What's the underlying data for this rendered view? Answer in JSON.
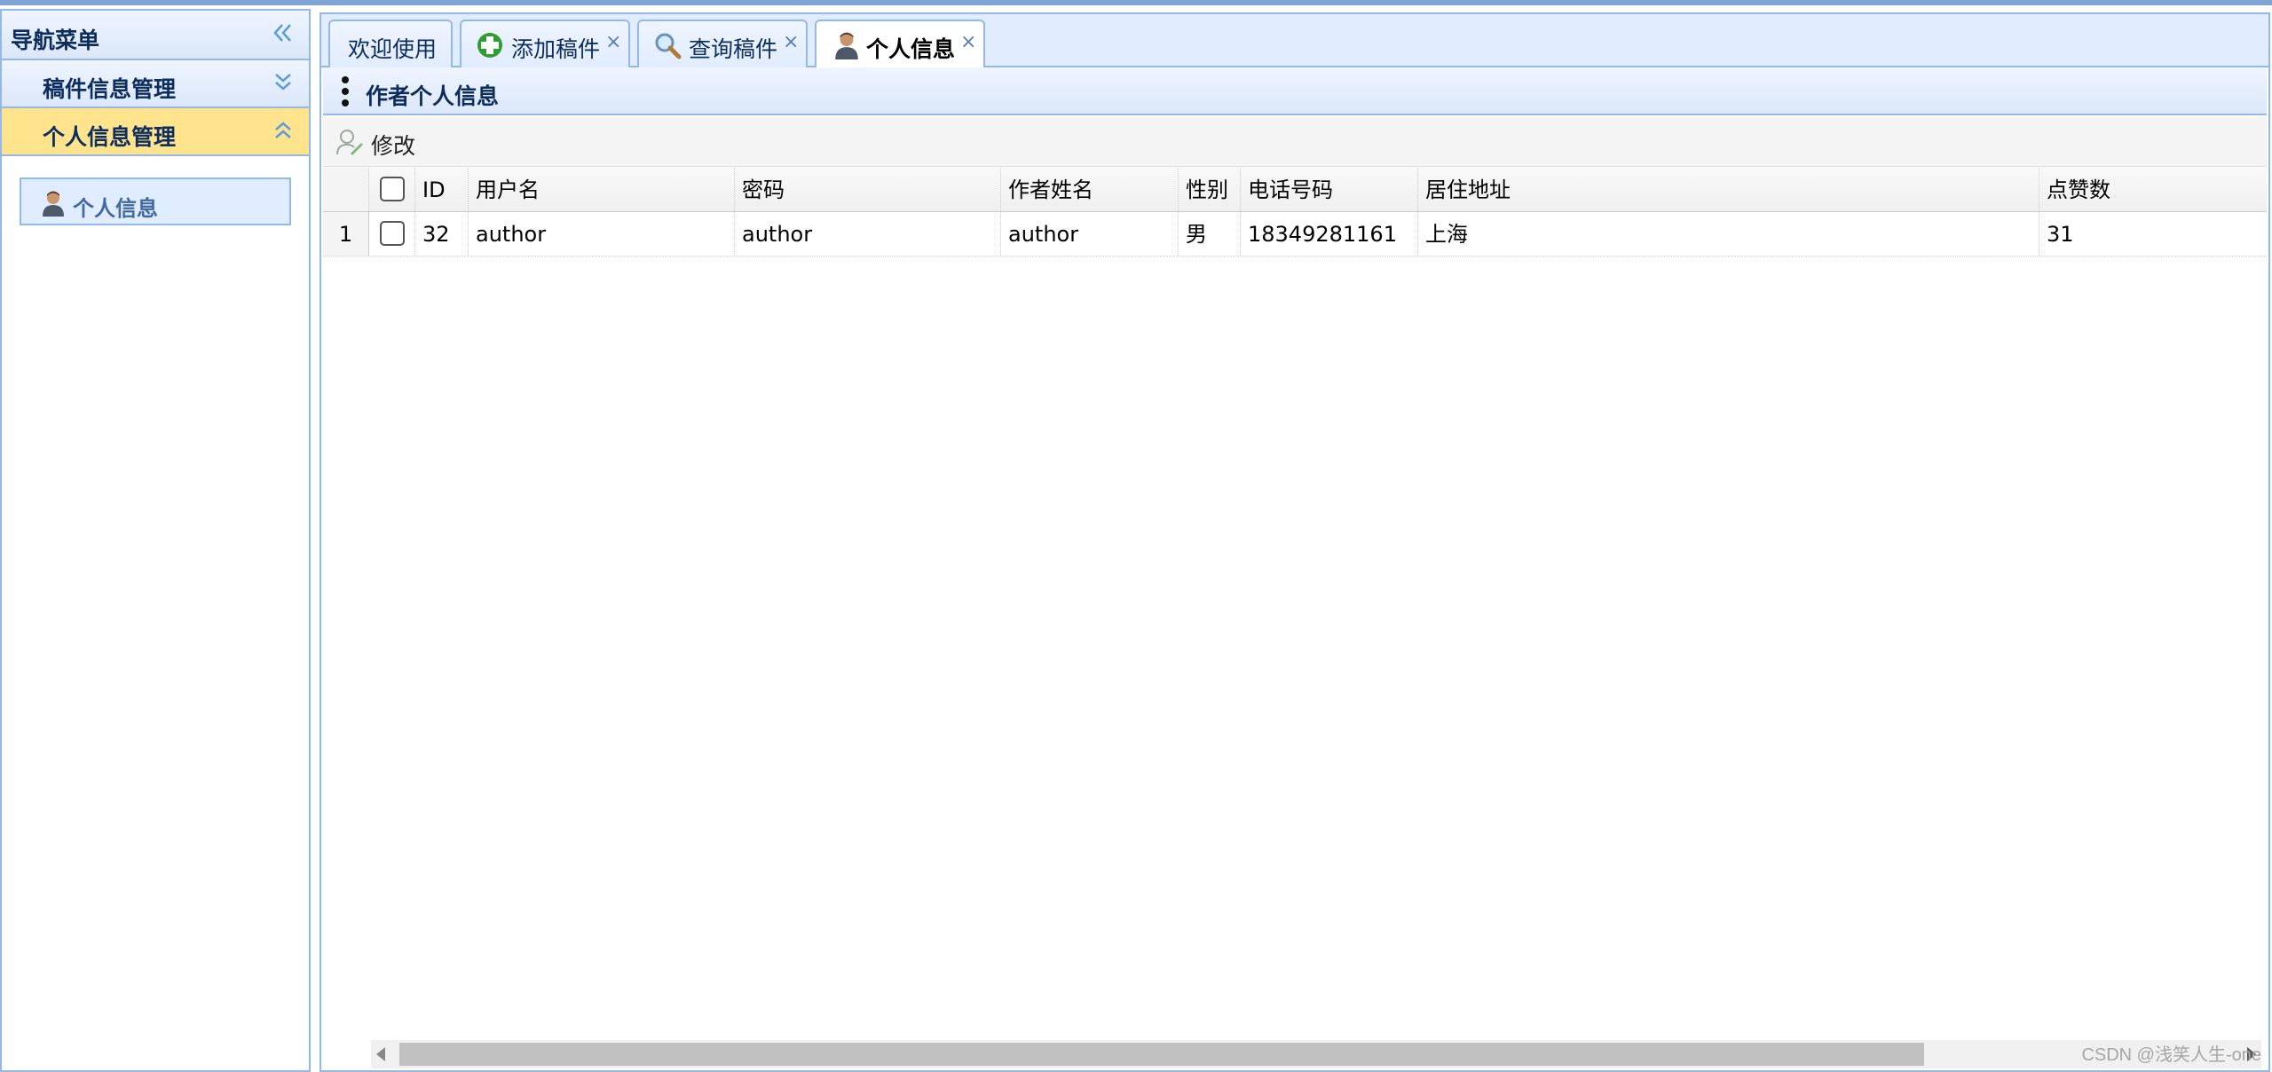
{
  "colors": {
    "accent_border": "#95b8e7",
    "header_bg": "#e0ecff",
    "active_group_bg": "#ffe48d",
    "title_text": "#0e2d5f"
  },
  "sidebar": {
    "title": "导航菜单",
    "collapse_icon": "double-chevron-left-icon",
    "groups": [
      {
        "label": "稿件信息管理",
        "state": "collapsed",
        "icon": "double-chevron-down-icon"
      },
      {
        "label": "个人信息管理",
        "state": "expanded",
        "icon": "double-chevron-up-icon"
      }
    ],
    "items": [
      {
        "label": "个人信息",
        "icon": "person-icon"
      }
    ]
  },
  "tabs": [
    {
      "label": "欢迎使用",
      "closable": false,
      "selected": false
    },
    {
      "label": "添加稿件",
      "icon": "green-plus-icon",
      "closable": true,
      "selected": false
    },
    {
      "label": "查询稿件",
      "icon": "magnifier-icon",
      "closable": true,
      "selected": false
    },
    {
      "label": "个人信息",
      "icon": "person-icon",
      "closable": true,
      "selected": true
    }
  ],
  "tab_close_glyph": "×",
  "panel": {
    "title": "作者个人信息"
  },
  "toolbar": {
    "edit_label": "修改",
    "edit_icon": "user-edit-icon"
  },
  "grid": {
    "columns": [
      "ID",
      "用户名",
      "密码",
      "作者姓名",
      "性别",
      "电话号码",
      "居住地址",
      "点赞数"
    ],
    "rows": [
      {
        "rownum": "1",
        "checked": false,
        "cells": [
          "32",
          "author",
          "author",
          "author",
          "男",
          "18349281161",
          "上海",
          "31"
        ]
      }
    ]
  },
  "watermark": "CSDN @浅笑人生-one"
}
